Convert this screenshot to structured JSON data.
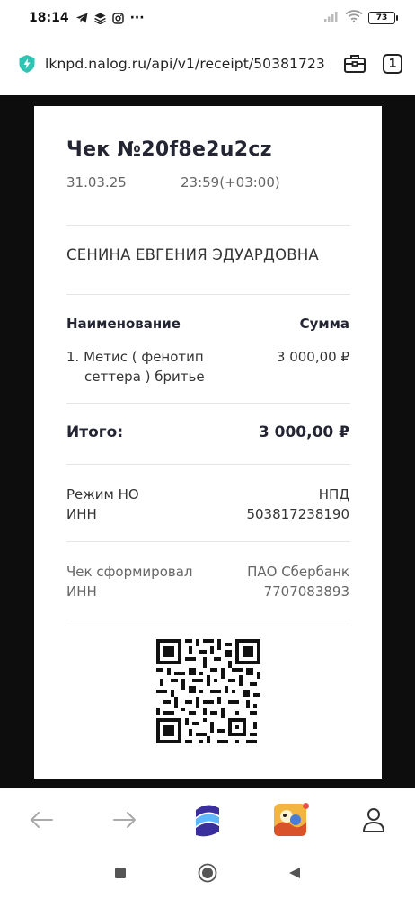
{
  "status_bar": {
    "time": "18:14",
    "more": "···",
    "battery": "73"
  },
  "browser": {
    "url": "lknpd.nalog.ru/api/v1/receipt/50381723",
    "tab_count": "1"
  },
  "receipt": {
    "title": "Чек №20f8e2u2cz",
    "date": "31.03.25",
    "time": "23:59(+03:00)",
    "seller": "СЕНИНА ЕВГЕНИЯ ЭДУАРДОВНА",
    "col_name": "Наименование",
    "col_sum": "Сумма",
    "item_line1": "1. Метис ( фенотип",
    "item_line2": "сеттера ) бритье",
    "item_sum": "3 000,00 ₽",
    "total_label": "Итого:",
    "total_value": "3 000,00 ₽",
    "tax_mode_label": "Режим НО",
    "tax_mode_value": "НПД",
    "inn_label": "ИНН",
    "inn_value": "503817238190",
    "formed_by_label": "Чек сформировал",
    "formed_by_value": "ПАО Сбербанк",
    "bank_inn_label": "ИНН",
    "bank_inn_value": "7707083893"
  },
  "icons": {
    "status": [
      "telegram-icon",
      "layers-icon",
      "instagram-icon",
      "signal-icon",
      "wifi-icon",
      "battery-icon"
    ],
    "browser": [
      "shield-icon",
      "toolbox-icon",
      "tabs-icon"
    ],
    "nav": [
      "back-arrow-icon",
      "forward-arrow-icon",
      "app-logo-icon",
      "game-icon",
      "profile-icon"
    ],
    "system": [
      "recents-icon",
      "home-icon",
      "back-icon"
    ]
  },
  "colors": {
    "accent_shield": "#2fc4b2",
    "notification_dot": "#e8504f",
    "logo_dark": "#3b2f9e",
    "logo_light": "#5fb8ff"
  }
}
